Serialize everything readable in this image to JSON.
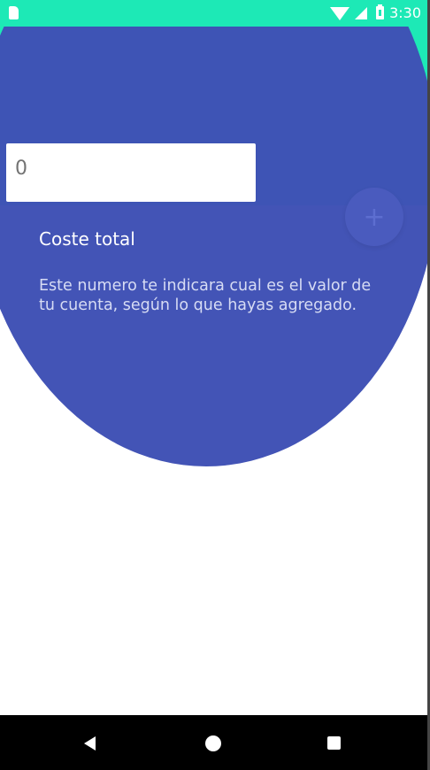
{
  "status_bar": {
    "time": "3:30",
    "icons": [
      "sd-card-icon",
      "wifi-icon",
      "signal-icon",
      "battery-icon"
    ]
  },
  "colors": {
    "accent": "#1de9b6",
    "overlay": "#3f51b5",
    "fab": "#4a5bbe"
  },
  "input": {
    "value": "0"
  },
  "fab": {
    "label": "+",
    "icon": "plus-icon"
  },
  "tooltip": {
    "title": "Coste total",
    "body": "Este numero te indicara cual es el valor de tu cuenta, según lo que hayas agregado."
  },
  "nav": {
    "icons": [
      "back-icon",
      "home-icon",
      "recents-icon"
    ]
  }
}
